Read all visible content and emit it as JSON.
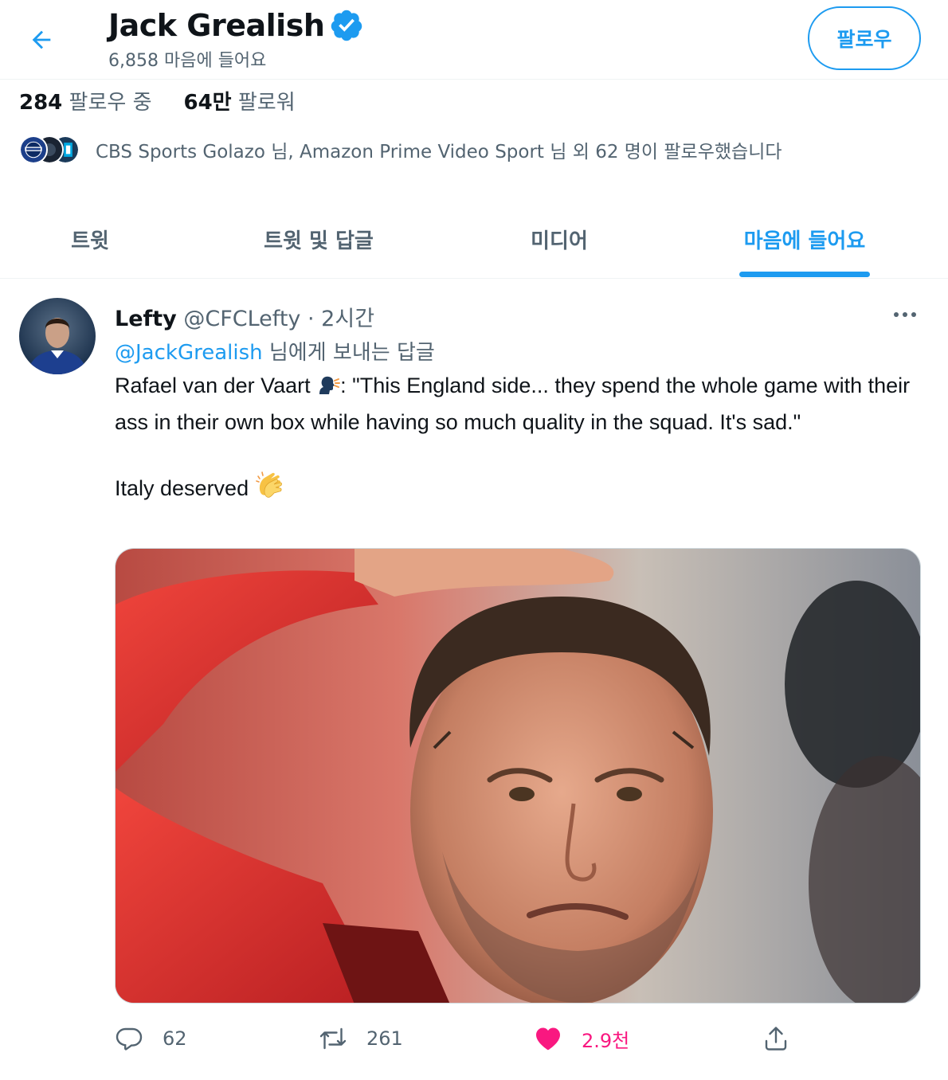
{
  "header": {
    "back_label": "←",
    "name": "Jack Grealish",
    "likes_count": "6,858 마음에 들어요",
    "follow_button": "팔로우",
    "accent_color": "#1d9bf0"
  },
  "stats": {
    "following_count": "284",
    "following_label": "팔로우 중",
    "followers_count": "64만",
    "followers_label": "팔로워"
  },
  "followed_by": {
    "text": "CBS Sports Golazo 님, Amazon Prime Video Sport 님 외 62 명이 팔로우했습니다"
  },
  "tabs": [
    {
      "label": "트윗",
      "active": false
    },
    {
      "label": "트윗 및 답글",
      "active": false
    },
    {
      "label": "미디어",
      "active": false
    },
    {
      "label": "마음에 들어요",
      "active": true
    }
  ],
  "tweet": {
    "author_name": "Lefty",
    "author_handle": "@CFCLefty",
    "separator": "·",
    "time": "2시간",
    "reply_mention": "@JackGrealish",
    "reply_suffix": "님에게 보내는 답글",
    "text_part1": "Rafael van der Vaart ",
    "text_part2": ": \"This England side... they spend the whole game with their ass in their own box while having so much quality in the squad. It's sad.\"",
    "text_part3": "Italy deserved ",
    "emoji_1": "speaking-head-icon",
    "emoji_2": "clapping-hands-icon",
    "actions": {
      "replies": "62",
      "retweets": "261",
      "likes": "2.9천",
      "like_color": "#f91880"
    }
  }
}
